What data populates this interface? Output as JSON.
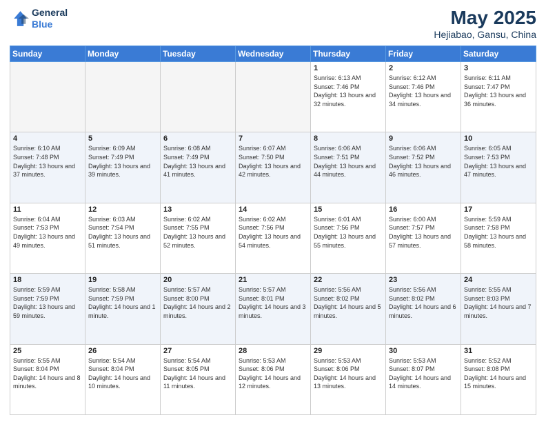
{
  "header": {
    "logo_line1": "General",
    "logo_line2": "Blue",
    "title": "May 2025",
    "subtitle": "Hejiabao, Gansu, China"
  },
  "days_of_week": [
    "Sunday",
    "Monday",
    "Tuesday",
    "Wednesday",
    "Thursday",
    "Friday",
    "Saturday"
  ],
  "weeks": [
    [
      {
        "day": "",
        "empty": true
      },
      {
        "day": "",
        "empty": true
      },
      {
        "day": "",
        "empty": true
      },
      {
        "day": "",
        "empty": true
      },
      {
        "day": "1",
        "rise": "6:13 AM",
        "set": "7:46 PM",
        "daylight": "13 hours and 32 minutes."
      },
      {
        "day": "2",
        "rise": "6:12 AM",
        "set": "7:46 PM",
        "daylight": "13 hours and 34 minutes."
      },
      {
        "day": "3",
        "rise": "6:11 AM",
        "set": "7:47 PM",
        "daylight": "13 hours and 36 minutes."
      }
    ],
    [
      {
        "day": "4",
        "rise": "6:10 AM",
        "set": "7:48 PM",
        "daylight": "13 hours and 37 minutes."
      },
      {
        "day": "5",
        "rise": "6:09 AM",
        "set": "7:49 PM",
        "daylight": "13 hours and 39 minutes."
      },
      {
        "day": "6",
        "rise": "6:08 AM",
        "set": "7:49 PM",
        "daylight": "13 hours and 41 minutes."
      },
      {
        "day": "7",
        "rise": "6:07 AM",
        "set": "7:50 PM",
        "daylight": "13 hours and 42 minutes."
      },
      {
        "day": "8",
        "rise": "6:06 AM",
        "set": "7:51 PM",
        "daylight": "13 hours and 44 minutes."
      },
      {
        "day": "9",
        "rise": "6:06 AM",
        "set": "7:52 PM",
        "daylight": "13 hours and 46 minutes."
      },
      {
        "day": "10",
        "rise": "6:05 AM",
        "set": "7:53 PM",
        "daylight": "13 hours and 47 minutes."
      }
    ],
    [
      {
        "day": "11",
        "rise": "6:04 AM",
        "set": "7:53 PM",
        "daylight": "13 hours and 49 minutes."
      },
      {
        "day": "12",
        "rise": "6:03 AM",
        "set": "7:54 PM",
        "daylight": "13 hours and 51 minutes."
      },
      {
        "day": "13",
        "rise": "6:02 AM",
        "set": "7:55 PM",
        "daylight": "13 hours and 52 minutes."
      },
      {
        "day": "14",
        "rise": "6:02 AM",
        "set": "7:56 PM",
        "daylight": "13 hours and 54 minutes."
      },
      {
        "day": "15",
        "rise": "6:01 AM",
        "set": "7:56 PM",
        "daylight": "13 hours and 55 minutes."
      },
      {
        "day": "16",
        "rise": "6:00 AM",
        "set": "7:57 PM",
        "daylight": "13 hours and 57 minutes."
      },
      {
        "day": "17",
        "rise": "5:59 AM",
        "set": "7:58 PM",
        "daylight": "13 hours and 58 minutes."
      }
    ],
    [
      {
        "day": "18",
        "rise": "5:59 AM",
        "set": "7:59 PM",
        "daylight": "13 hours and 59 minutes."
      },
      {
        "day": "19",
        "rise": "5:58 AM",
        "set": "7:59 PM",
        "daylight": "14 hours and 1 minute."
      },
      {
        "day": "20",
        "rise": "5:57 AM",
        "set": "8:00 PM",
        "daylight": "14 hours and 2 minutes."
      },
      {
        "day": "21",
        "rise": "5:57 AM",
        "set": "8:01 PM",
        "daylight": "14 hours and 3 minutes."
      },
      {
        "day": "22",
        "rise": "5:56 AM",
        "set": "8:02 PM",
        "daylight": "14 hours and 5 minutes."
      },
      {
        "day": "23",
        "rise": "5:56 AM",
        "set": "8:02 PM",
        "daylight": "14 hours and 6 minutes."
      },
      {
        "day": "24",
        "rise": "5:55 AM",
        "set": "8:03 PM",
        "daylight": "14 hours and 7 minutes."
      }
    ],
    [
      {
        "day": "25",
        "rise": "5:55 AM",
        "set": "8:04 PM",
        "daylight": "14 hours and 8 minutes."
      },
      {
        "day": "26",
        "rise": "5:54 AM",
        "set": "8:04 PM",
        "daylight": "14 hours and 10 minutes."
      },
      {
        "day": "27",
        "rise": "5:54 AM",
        "set": "8:05 PM",
        "daylight": "14 hours and 11 minutes."
      },
      {
        "day": "28",
        "rise": "5:53 AM",
        "set": "8:06 PM",
        "daylight": "14 hours and 12 minutes."
      },
      {
        "day": "29",
        "rise": "5:53 AM",
        "set": "8:06 PM",
        "daylight": "14 hours and 13 minutes."
      },
      {
        "day": "30",
        "rise": "5:53 AM",
        "set": "8:07 PM",
        "daylight": "14 hours and 14 minutes."
      },
      {
        "day": "31",
        "rise": "5:52 AM",
        "set": "8:08 PM",
        "daylight": "14 hours and 15 minutes."
      }
    ]
  ]
}
